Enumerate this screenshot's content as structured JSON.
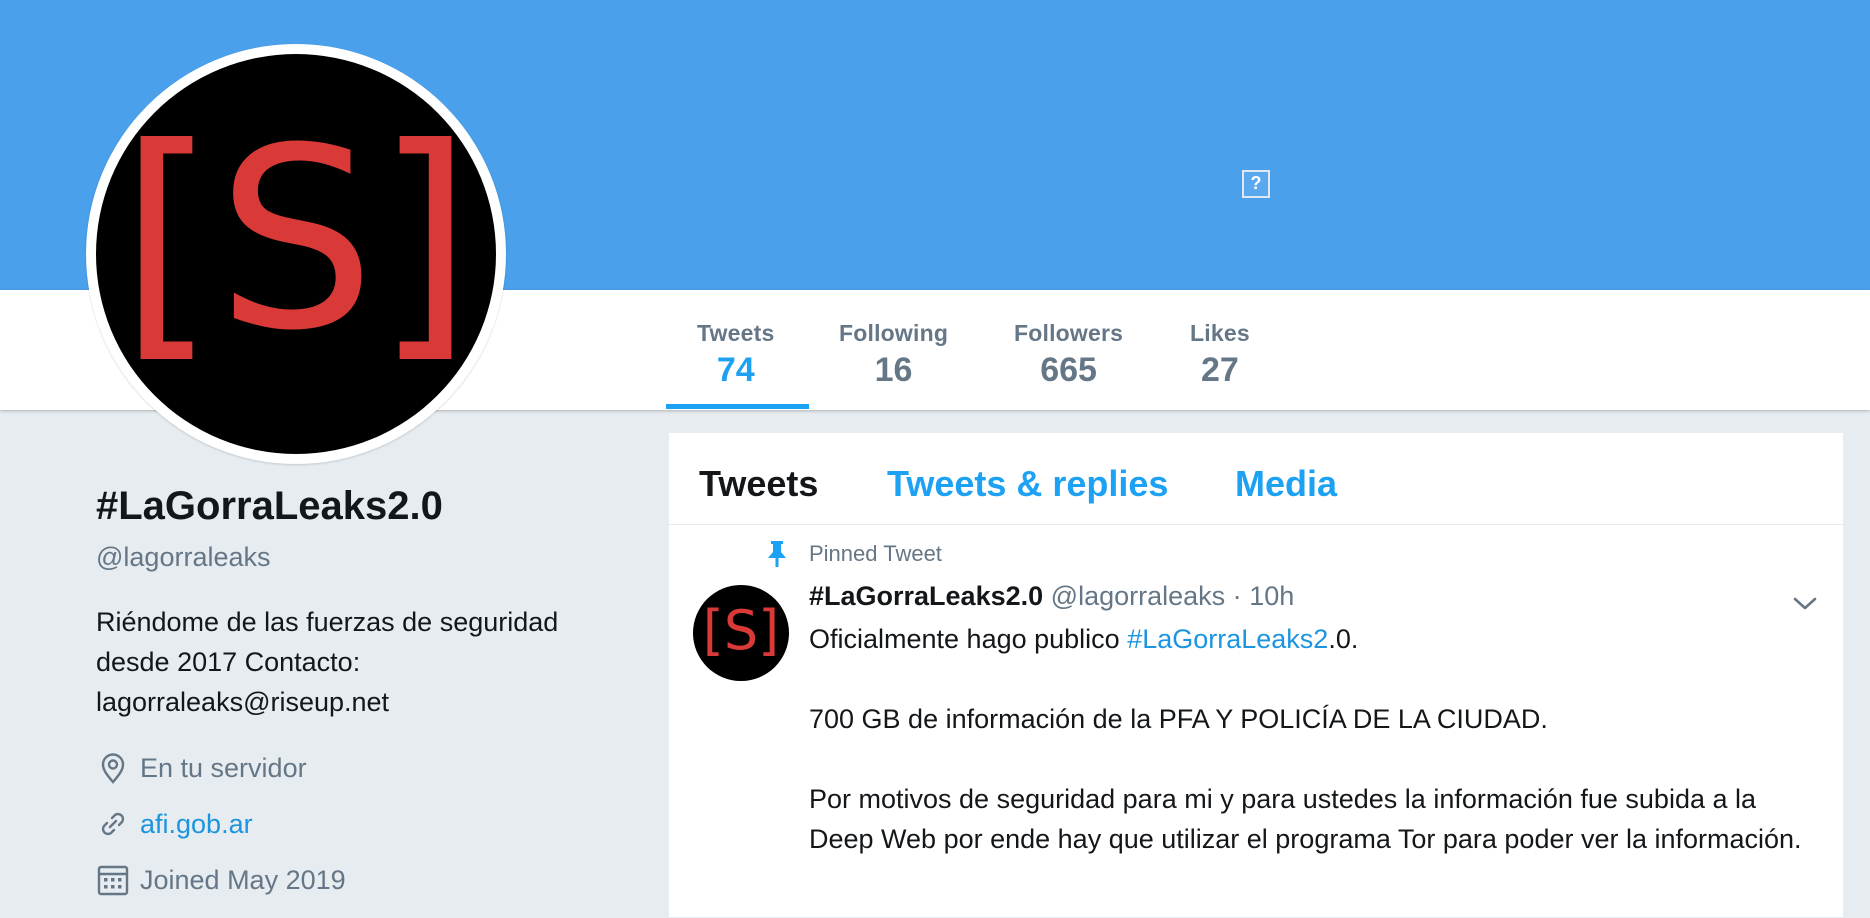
{
  "colors": {
    "banner": "#4aa0eb",
    "accent": "#1da1f2",
    "muted": "#657786",
    "avatar_letter": "#d93a37"
  },
  "banner": {
    "broken_image_glyph": "?"
  },
  "profile": {
    "avatar_text": "[S]",
    "name": "#LaGorraLeaks2.0",
    "handle": "@lagorraleaks",
    "bio": "Riéndome de las fuerzas de seguridad desde 2017 Contacto: lagorraleaks@riseup.net",
    "location": "En tu servidor",
    "website": "afi.gob.ar",
    "joined": "Joined May 2019"
  },
  "stats": [
    {
      "label": "Tweets",
      "value": "74",
      "active": true
    },
    {
      "label": "Following",
      "value": "16"
    },
    {
      "label": "Followers",
      "value": "665"
    },
    {
      "label": "Likes",
      "value": "27"
    }
  ],
  "tabs": [
    {
      "label": "Tweets",
      "active": true
    },
    {
      "label": "Tweets & replies"
    },
    {
      "label": "Media"
    }
  ],
  "pinned_tweet": {
    "pinned_label": "Pinned Tweet",
    "author_name": "#LaGorraLeaks2.0",
    "author_handle": "@lagorraleaks",
    "separator": "·",
    "time": "10h",
    "line1_prefix": "Oficialmente hago publico ",
    "line1_hashtag": "#LaGorraLeaks2",
    "line1_suffix": ".0.",
    "paragraph2": "700 GB de información de la PFA Y POLICÍA DE LA CIUDAD.",
    "paragraph3": "Por motivos de seguridad para mi y para ustedes la información fue subida a la Deep Web por ende hay que utilizar el programa Tor para poder ver la información."
  }
}
